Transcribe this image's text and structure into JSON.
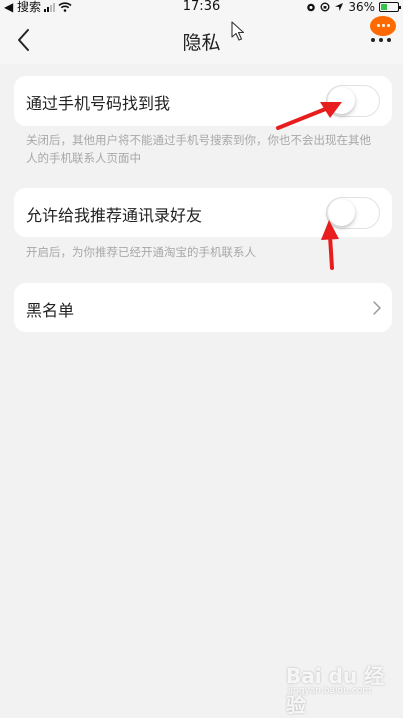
{
  "status_bar": {
    "back_app": "◀ 搜索",
    "time": "17:36",
    "battery": "36%"
  },
  "nav": {
    "title": "隐私",
    "back_icon": "chevron-left-icon",
    "more_icon": "more-dots-icon"
  },
  "settings": [
    {
      "label": "通过手机号码找到我",
      "enabled": false,
      "description": "关闭后，其他用户将不能通过手机号搜索到你，你也不会出现在其他人的手机联系人页面中"
    },
    {
      "label": "允许给我推荐通讯录好友",
      "enabled": false,
      "description": "开启后，为你推荐已经开通淘宝的手机联系人"
    }
  ],
  "blacklist": {
    "label": "黑名单"
  },
  "watermark": {
    "brand": "Bai du 经验",
    "url": "jingyan.baidu.com"
  },
  "colors": {
    "page_bg": "#f2f2f2",
    "accent_badge": "#ff6a00",
    "annotation_arrow": "#e81e1e",
    "description_text": "#a8a8a8"
  }
}
